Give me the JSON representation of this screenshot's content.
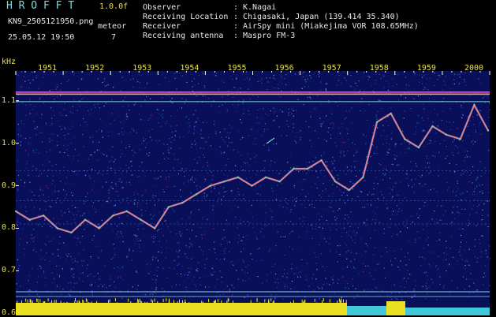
{
  "header": {
    "logo_text": "H R O F F T",
    "version": "1.0.0f",
    "filename": "KN9_2505121950.png",
    "meteor_label": "meteor",
    "datetime": "25.05.12 19:50",
    "meteor_count": "7",
    "info": [
      {
        "label": "Observer",
        "value": "K.Nagai"
      },
      {
        "label": "Receiving Location",
        "value": "Chigasaki, Japan (139.414 35.340)"
      },
      {
        "label": "Receiver",
        "value": "AirSpy mini (Miakejima VOR 108.65MHz)"
      },
      {
        "label": "Receiving antenna",
        "value": "Maspro FM-3"
      }
    ],
    "colors": {
      "label": "#7fd8e0",
      "value": "#e8e04a",
      "logo": "#7fd8e0"
    }
  },
  "chart_data": {
    "type": "line",
    "title": "",
    "ylabel": "kHz",
    "xlabel": "",
    "x_tick_labels": [
      "1951",
      "1952",
      "1953",
      "1954",
      "1955",
      "1956",
      "1957",
      "1958",
      "1959",
      "2000"
    ],
    "y_tick_labels": [
      "1.1",
      "1.0",
      "0.9",
      "0.8",
      "0.7",
      "0.6"
    ],
    "y_ticks": [
      1.1,
      1.0,
      0.9,
      0.8,
      0.7,
      0.6
    ],
    "ylim": [
      0.595,
      1.17
    ],
    "xlim": [
      19.5,
      20.0
    ],
    "x_tick_values": [
      19.51,
      19.52,
      19.53,
      19.54,
      19.55,
      19.56,
      19.57,
      19.58,
      19.59,
      20.0
    ],
    "background": "#0a0f5a",
    "signal_line_kHz": 1.118,
    "series": [
      {
        "x": [
          19.5,
          19.503,
          19.506,
          19.509,
          19.512,
          19.515,
          19.518,
          19.521,
          19.524,
          19.527,
          19.53,
          19.533,
          19.536,
          19.539,
          19.542,
          19.545,
          19.548,
          19.551,
          19.554,
          19.557,
          19.56,
          19.563,
          19.566,
          19.569,
          19.572,
          19.575,
          19.578,
          19.581,
          19.584,
          19.587,
          19.59,
          19.593,
          19.596,
          19.599,
          20.0
        ],
        "values": [
          0.84,
          0.82,
          0.83,
          0.8,
          0.79,
          0.82,
          0.8,
          0.83,
          0.84,
          0.82,
          0.8,
          0.85,
          0.86,
          0.88,
          0.9,
          0.91,
          0.92,
          0.9,
          0.92,
          0.91,
          0.94,
          0.94,
          0.96,
          0.91,
          0.89,
          0.92,
          1.05,
          1.07,
          1.01,
          0.99,
          1.04,
          1.02,
          1.01,
          1.09,
          1.03
        ]
      }
    ],
    "noise_band": {
      "description": "yellow and cyan strip at bottom"
    }
  }
}
